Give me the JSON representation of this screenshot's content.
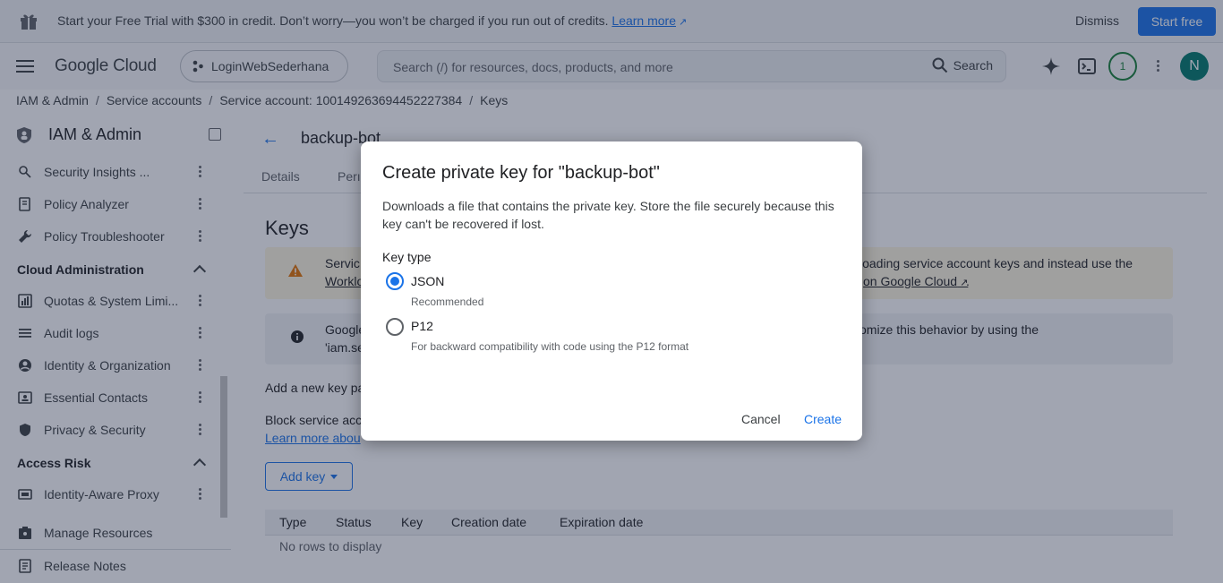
{
  "banner": {
    "message": "Start your Free Trial with $300 in credit. Don’t worry—you won’t be charged if you run out of credits.",
    "learn_more": "Learn more",
    "dismiss": "Dismiss",
    "start_free": "Start free"
  },
  "header": {
    "logo": "Google Cloud",
    "project": "LoginWebSederhana",
    "search_placeholder": "Search (/) for resources, docs, products, and more",
    "search_button": "Search",
    "notifications_count": "1",
    "avatar_initial": "N"
  },
  "breadcrumb": [
    "IAM & Admin",
    "Service accounts",
    "Service account: 100149263694452227384",
    "Keys"
  ],
  "sidebar": {
    "title": "IAM & Admin",
    "items": [
      {
        "label": "Security Insights ..."
      },
      {
        "label": "Policy Analyzer"
      },
      {
        "label": "Policy Troubleshooter"
      }
    ],
    "section_cloud_admin": "Cloud Administration",
    "cloud_admin_items": [
      {
        "label": "Quotas & System Limi..."
      },
      {
        "label": "Audit logs"
      },
      {
        "label": "Identity & Organization"
      },
      {
        "label": "Essential Contacts"
      },
      {
        "label": "Privacy & Security"
      }
    ],
    "section_access_risk": "Access Risk",
    "access_risk_items": [
      {
        "label": "Identity-Aware Proxy"
      }
    ],
    "manage_resources": "Manage Resources",
    "release_notes": "Release Notes"
  },
  "main": {
    "title": "backup-bot",
    "tabs": [
      "Details",
      "Perı"
    ],
    "keys_heading": "Keys",
    "warning": {
      "line1_left": "Servic",
      "line2_left": "Worklo",
      "line1_right": "loading service account keys and instead use the",
      "line2_right": "on Google Cloud"
    },
    "info": {
      "line1_left": "Google",
      "line2_left": "'iam.se",
      "line1_right": "omize this behavior by using the"
    },
    "add_new_key_text": "Add a new key pa",
    "block_text": "Block service acc",
    "learn_more_text": "Learn more abou",
    "add_key_button": "Add key",
    "table": {
      "columns": [
        "Type",
        "Status",
        "Key",
        "Creation date",
        "Expiration date"
      ],
      "empty": "No rows to display"
    }
  },
  "dialog": {
    "title": "Create private key for \"backup-bot\"",
    "description": "Downloads a file that contains the private key. Store the file securely because this key can't be recovered if lost.",
    "key_type_label": "Key type",
    "options": [
      {
        "label": "JSON",
        "help": "Recommended",
        "selected": true
      },
      {
        "label": "P12",
        "help": "For backward compatibility with code using the P12 format",
        "selected": false
      }
    ],
    "cancel": "Cancel",
    "create": "Create"
  },
  "colors": {
    "accent": "#1a73e8",
    "avatar": "#00796b",
    "notification": "#188038",
    "warning_bg": "#fef7e0"
  }
}
